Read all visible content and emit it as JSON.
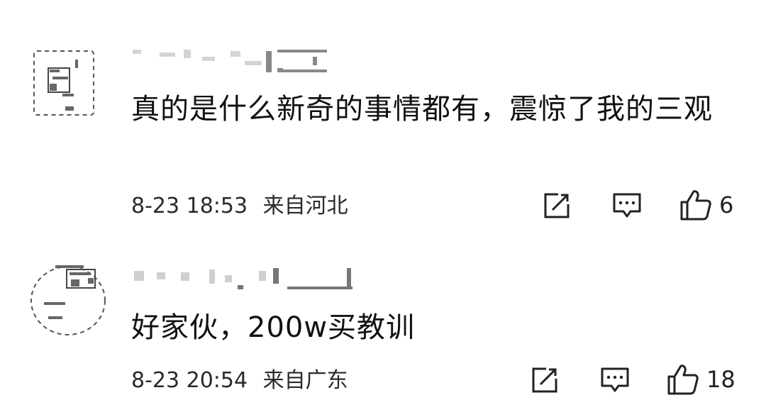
{
  "comments": [
    {
      "text": "真的是什么新奇的事情都有，震惊了我的三观",
      "date": "8-23 18:53",
      "location": "来自河北",
      "like_count": "6",
      "avatar_icon": "avatar-icon",
      "reply_icon": "edit-icon",
      "comment_icon": "comment-icon",
      "like_icon": "thumbs-up-icon"
    },
    {
      "text": "好家伙，200w买教训",
      "date": "8-23 20:54",
      "location": "来自广东",
      "like_count": "18",
      "avatar_icon": "avatar-icon",
      "reply_icon": "edit-icon",
      "comment_icon": "comment-icon",
      "like_icon": "thumbs-up-icon"
    }
  ]
}
